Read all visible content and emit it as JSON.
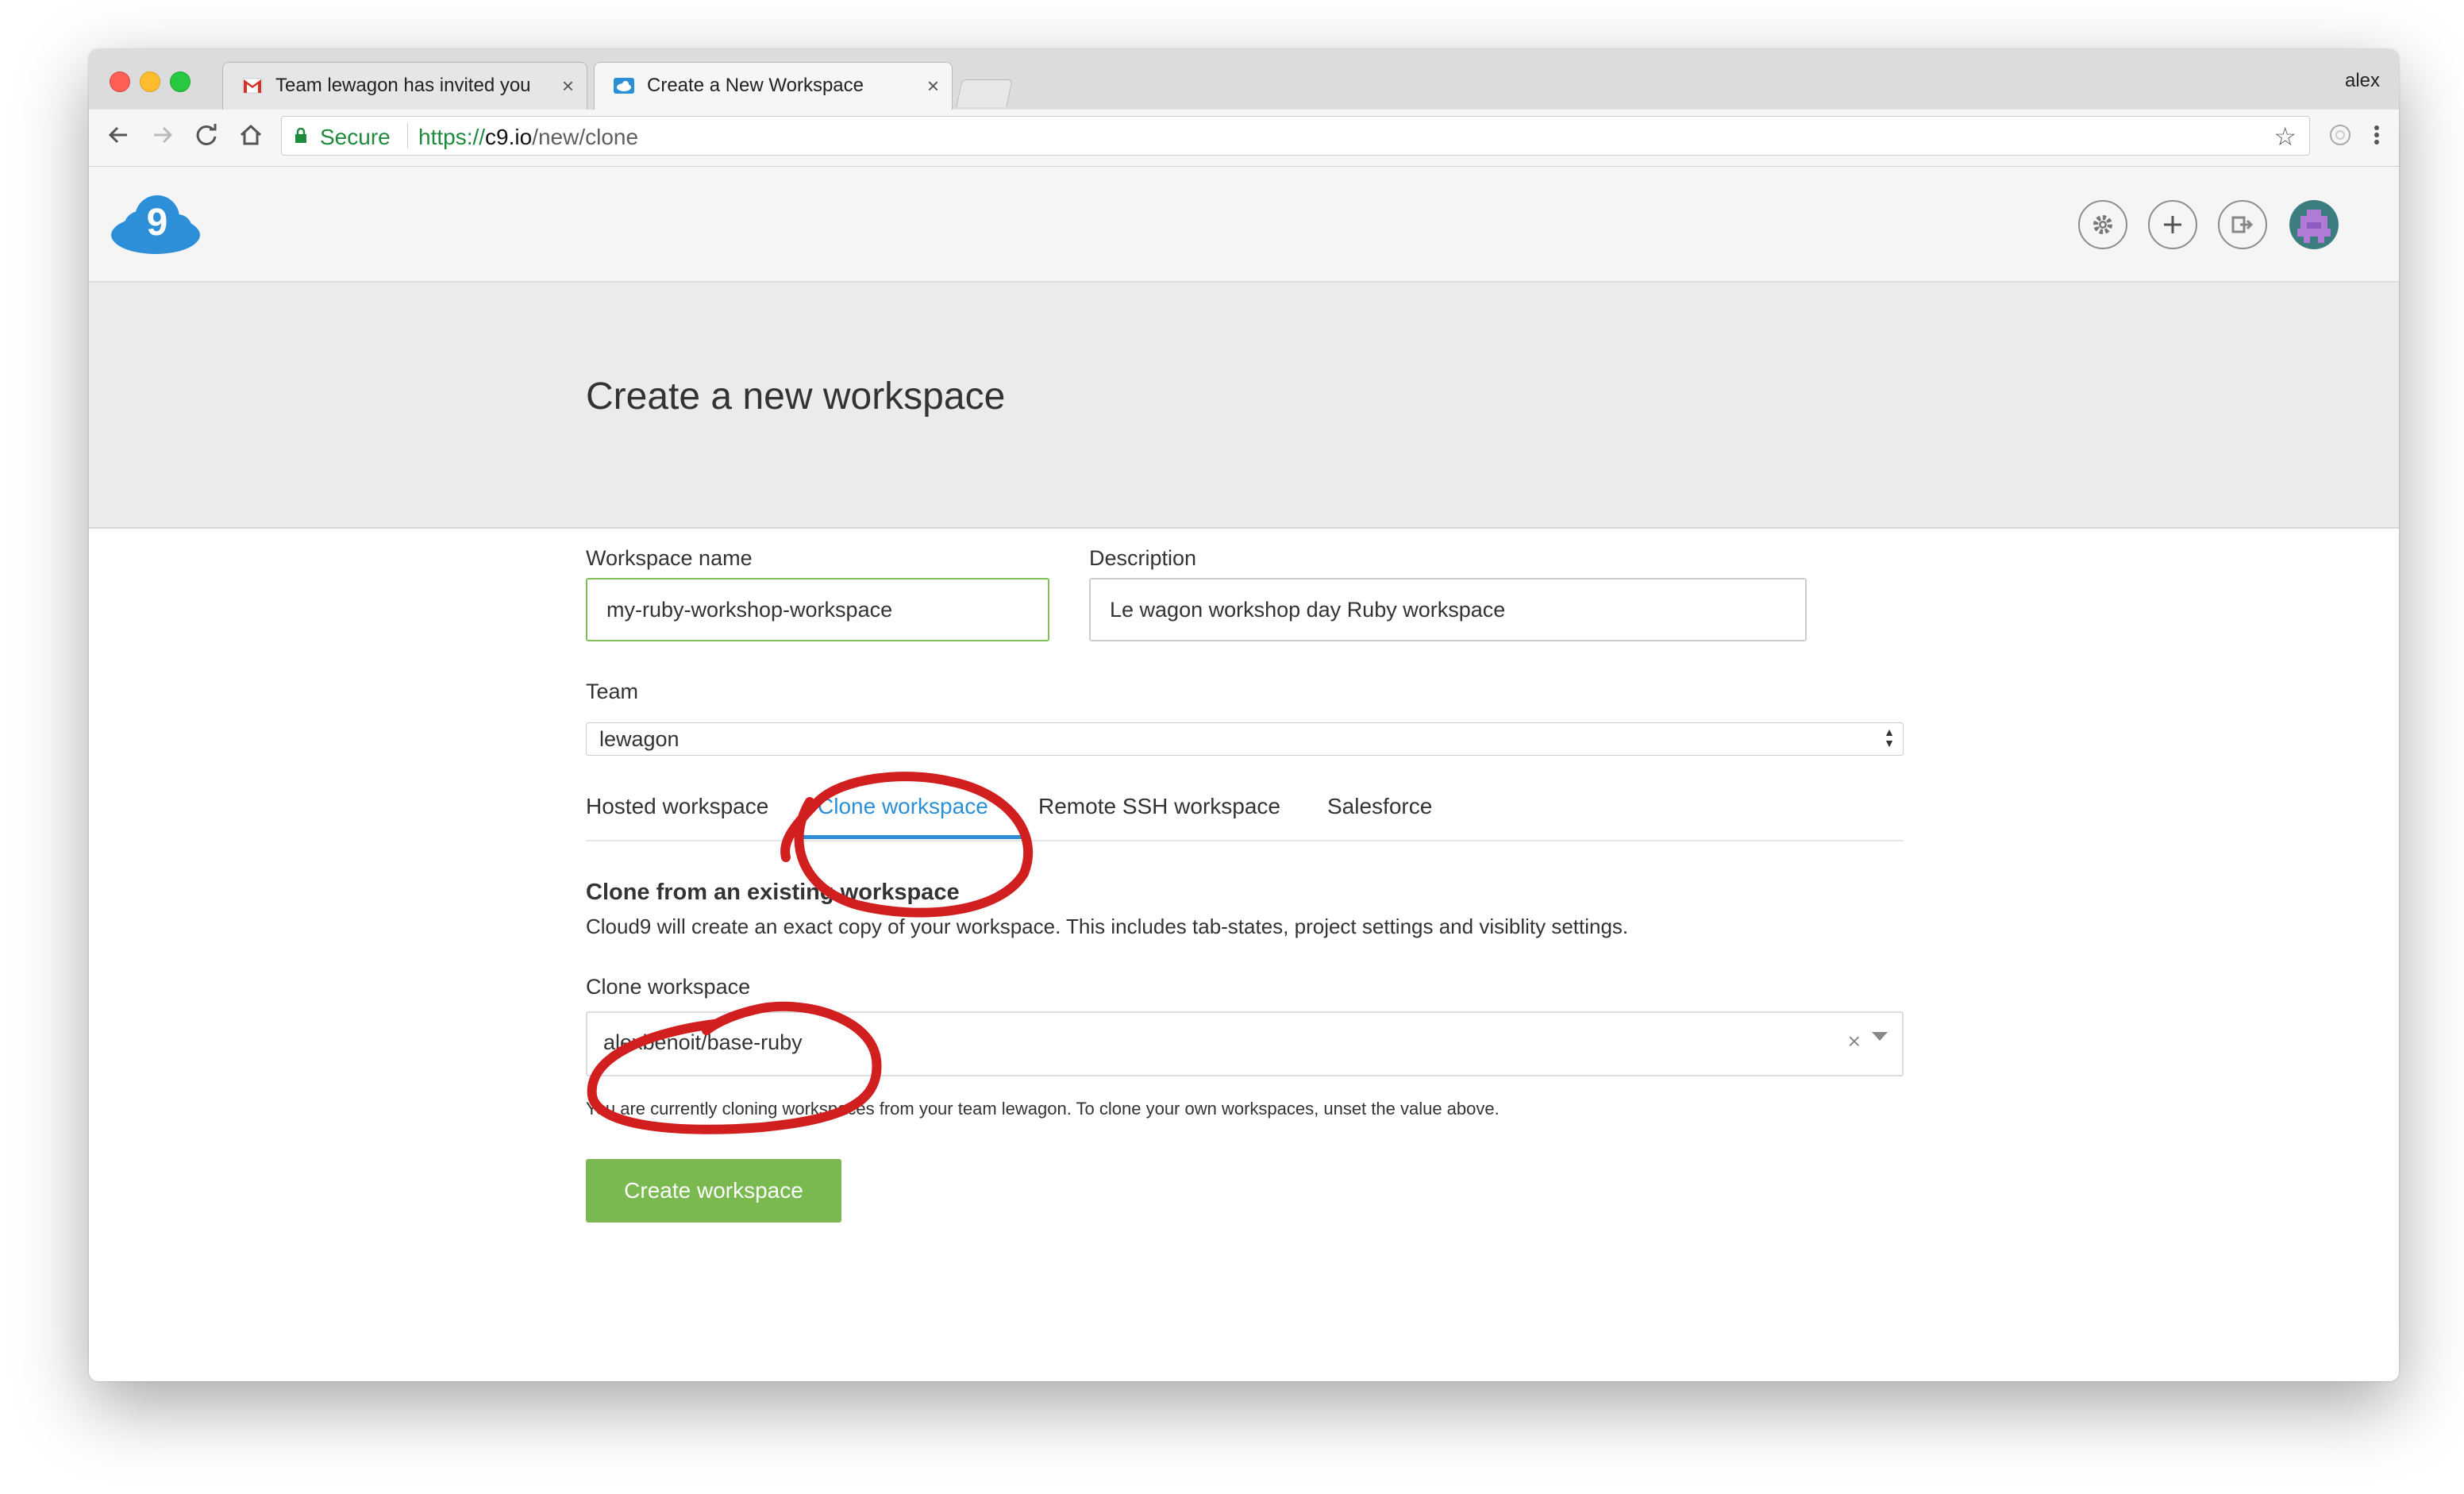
{
  "browser": {
    "tabs": [
      {
        "title": "Team lewagon has invited you",
        "favicon": "gmail-icon"
      },
      {
        "title": "Create a New Workspace",
        "favicon": "cloud9-icon"
      }
    ],
    "close_symbol": "×",
    "profile_name": "alex",
    "secure_label": "Secure",
    "url_scheme": "https://",
    "url_host": "c9.io",
    "url_path": "/new/clone"
  },
  "header": {
    "logo_text": "9",
    "icons": [
      "gear-icon",
      "plus-icon",
      "logout-icon",
      "avatar"
    ]
  },
  "hero": {
    "title": "Create a new workspace"
  },
  "form": {
    "workspace_name_label": "Workspace name",
    "workspace_name_value": "my-ruby-workshop-workspace",
    "description_label": "Description",
    "description_value": "Le wagon workshop day Ruby workspace",
    "team_label": "Team",
    "team_value": "lewagon",
    "tabs": [
      {
        "label": "Hosted workspace",
        "active": false
      },
      {
        "label": "Clone workspace",
        "active": true
      },
      {
        "label": "Remote SSH workspace",
        "active": false
      },
      {
        "label": "Salesforce",
        "active": false
      }
    ],
    "section_title": "Clone from an existing workspace",
    "section_desc": "Cloud9 will create an exact copy of your workspace. This includes tab-states, project settings and visiblity settings.",
    "clone_label": "Clone workspace",
    "clone_value": "alexbenoit/base-ruby",
    "clear_symbol": "×",
    "hint": "You are currently cloning workspaces from your team lewagon. To clone your own workspaces, unset the value above.",
    "create_button": "Create workspace"
  },
  "colors": {
    "accent_blue": "#2b8fd6",
    "button_green": "#79b94f",
    "annotation_red": "#d11f1f",
    "secure_green": "#1e8a3c"
  }
}
